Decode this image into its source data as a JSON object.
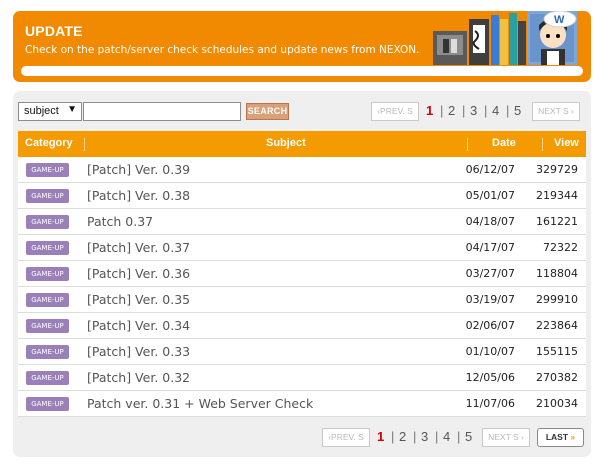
{
  "header": {
    "title": "UPDATE",
    "subtitle": "Check on the patch/server check schedules and update news from NEXON.",
    "mascot_badge": "W"
  },
  "search": {
    "field_selected": "subject",
    "field_arrow": "▼",
    "query_value": "",
    "button_label": "SEARCH"
  },
  "top_pager": {
    "prev_label": "‹PREV. S",
    "pages": [
      "1",
      "2",
      "3",
      "4",
      "5"
    ],
    "current": "1",
    "next_label": "NEXT S ›"
  },
  "bottom_pager": {
    "prev_label": "‹PREV. S",
    "pages": [
      "1",
      "2",
      "3",
      "4",
      "5"
    ],
    "current": "1",
    "next_label": "NEXT S ›",
    "last_label": "LAST",
    "last_icon": "»"
  },
  "table": {
    "columns": {
      "category": "Category",
      "subject": "Subject",
      "date": "Date",
      "view": "View"
    },
    "rows": [
      {
        "category": "GAME-UP",
        "subject": "[Patch] Ver. 0.39",
        "date": "06/12/07",
        "view": "329729"
      },
      {
        "category": "GAME-UP",
        "subject": "[Patch] Ver. 0.38",
        "date": "05/01/07",
        "view": "219344"
      },
      {
        "category": "GAME-UP",
        "subject": "Patch 0.37",
        "date": "04/18/07",
        "view": "161221"
      },
      {
        "category": "GAME-UP",
        "subject": "[Patch] Ver. 0.37",
        "date": "04/17/07",
        "view": "72322"
      },
      {
        "category": "GAME-UP",
        "subject": "[Patch] Ver. 0.36",
        "date": "03/27/07",
        "view": "118804"
      },
      {
        "category": "GAME-UP",
        "subject": "[Patch] Ver. 0.35",
        "date": "03/19/07",
        "view": "299910"
      },
      {
        "category": "GAME-UP",
        "subject": "[Patch] Ver. 0.34",
        "date": "02/06/07",
        "view": "223864"
      },
      {
        "category": "GAME-UP",
        "subject": "[Patch] Ver. 0.33",
        "date": "01/10/07",
        "view": "155115"
      },
      {
        "category": "GAME-UP",
        "subject": "[Patch] Ver. 0.32",
        "date": "12/05/06",
        "view": "270382"
      },
      {
        "category": "GAME-UP",
        "subject": "Patch ver. 0.31 + Web Server Check",
        "date": "11/07/06",
        "view": "210034"
      }
    ]
  },
  "colors": {
    "brand_orange": "#f18a00",
    "header_orange": "#f39b00",
    "tag_purple": "#9a7fb9",
    "active_page_red": "#d20000"
  }
}
